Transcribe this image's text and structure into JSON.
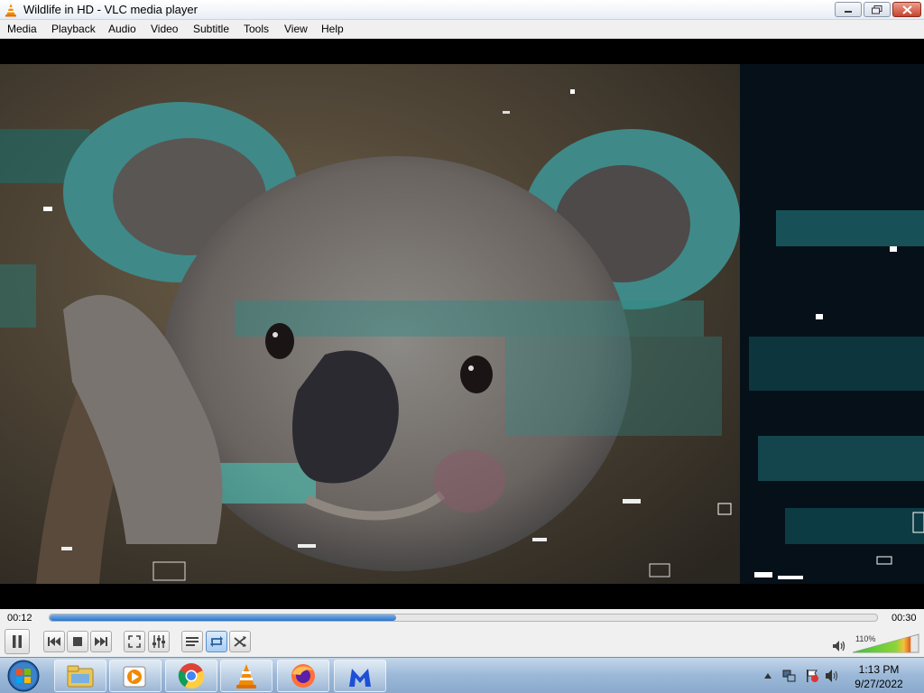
{
  "window": {
    "title": "Wildlife in HD - VLC media player"
  },
  "menu": [
    "Media",
    "Playback",
    "Audio",
    "Video",
    "Subtitle",
    "Tools",
    "View",
    "Help"
  ],
  "player": {
    "time_elapsed": "00:12",
    "time_total": "00:30",
    "progress": 0.419,
    "volume_label": "110%",
    "volume_level": 1.1
  },
  "controls": {
    "icons": [
      "pause-icon",
      "previous-icon",
      "stop-icon",
      "next-icon",
      "fullscreen-icon",
      "extended-settings-icon",
      "playlist-icon",
      "loop-icon",
      "shuffle-icon",
      "speaker-icon"
    ]
  },
  "taskbar": {
    "apps": [
      "windows-explorer-icon",
      "media-player-icon",
      "chrome-icon",
      "vlc-icon",
      "firefox-icon",
      "malwarebytes-icon"
    ],
    "clock_time": "1:13 PM",
    "clock_date": "9/27/2022"
  },
  "colors": {
    "accent": "#2a74c9",
    "vlc_orange": "#f28a00",
    "taskbar": "#9bb8d8"
  }
}
